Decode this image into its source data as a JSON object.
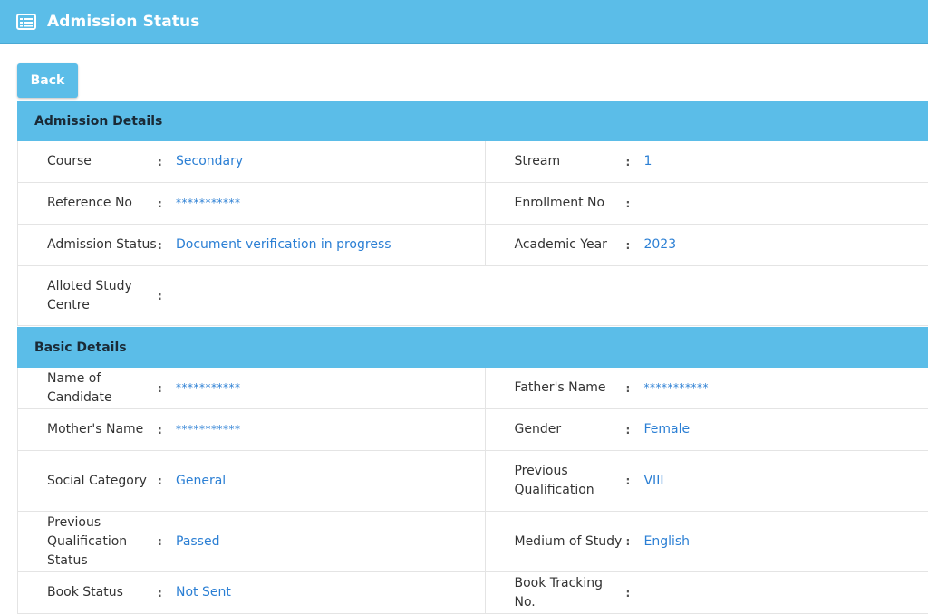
{
  "header": {
    "title": "Admission Status",
    "icon": "list-icon",
    "bg_color": "#5bbde8"
  },
  "actions": {
    "back_label": "Back"
  },
  "admission_details": {
    "heading": "Admission Details",
    "rows": [
      [
        {
          "label": "Course",
          "value": "Secondary"
        },
        {
          "label": "Stream",
          "value": "1"
        }
      ],
      [
        {
          "label": "Reference No",
          "value": "***********"
        },
        {
          "label": "Enrollment No",
          "value": ""
        }
      ],
      [
        {
          "label": "Admission Status",
          "value": "Document verification in progress"
        },
        {
          "label": "Academic Year",
          "value": "2023"
        }
      ],
      [
        {
          "label": "Alloted Study Centre",
          "value": ""
        }
      ]
    ]
  },
  "basic_details": {
    "heading": "Basic Details",
    "rows": [
      [
        {
          "label": "Name of Candidate",
          "value": "***********"
        },
        {
          "label": "Father's Name",
          "value": "***********"
        }
      ],
      [
        {
          "label": "Mother's Name",
          "value": "***********"
        },
        {
          "label": "Gender",
          "value": "Female"
        }
      ],
      [
        {
          "label": "Social Category",
          "value": "General"
        },
        {
          "label": "Previous Qualification",
          "value": "VIII"
        }
      ],
      [
        {
          "label": "Previous Qualification Status",
          "value": "Passed"
        },
        {
          "label": "Medium of Study",
          "value": "English"
        }
      ],
      [
        {
          "label": "Book Status",
          "value": "Not Sent"
        },
        {
          "label": "Book Tracking No.",
          "value": ""
        }
      ]
    ]
  },
  "colon": ":"
}
